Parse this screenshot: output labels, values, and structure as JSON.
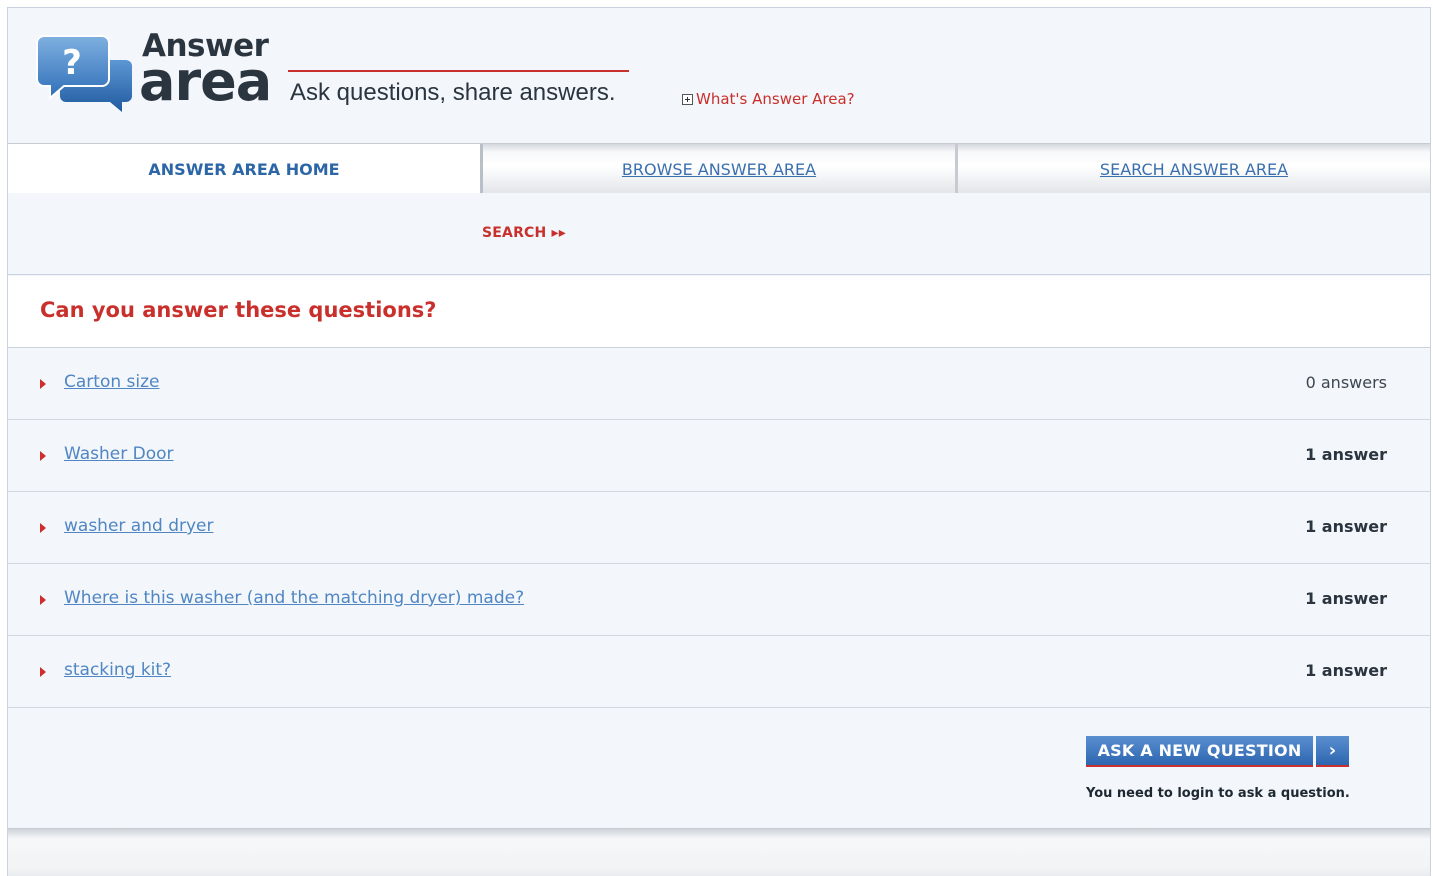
{
  "header": {
    "logo_word1": "Answer",
    "logo_word2": "area",
    "tagline": "Ask questions, share answers.",
    "whats_link": "What's Answer Area?"
  },
  "tabs": [
    {
      "label": "ANSWER AREA HOME",
      "active": true
    },
    {
      "label": "BROWSE ANSWER AREA",
      "active": false
    },
    {
      "label": "SEARCH ANSWER AREA",
      "active": false
    }
  ],
  "search": {
    "label": "SEARCH ▸▸"
  },
  "questions": {
    "title": "Can you answer these questions?",
    "items": [
      {
        "text": "Carton size",
        "count": "0 answers"
      },
      {
        "text": "Washer Door",
        "count": "1 answer"
      },
      {
        "text": "washer and dryer",
        "count": "1 answer"
      },
      {
        "text": "Where is this washer (and the matching dryer) made?",
        "count": "1 answer"
      },
      {
        "text": "stacking kit?",
        "count": "1 answer"
      }
    ]
  },
  "ask": {
    "button_label": "ASK A NEW QUESTION",
    "arrow_label": "›",
    "login_note": "You need to login to ask a question."
  },
  "colors": {
    "accent_red": "#c9302c",
    "link_blue": "#4f86c3",
    "button_blue": "#2d66b0",
    "background": "#f3f6fa"
  }
}
